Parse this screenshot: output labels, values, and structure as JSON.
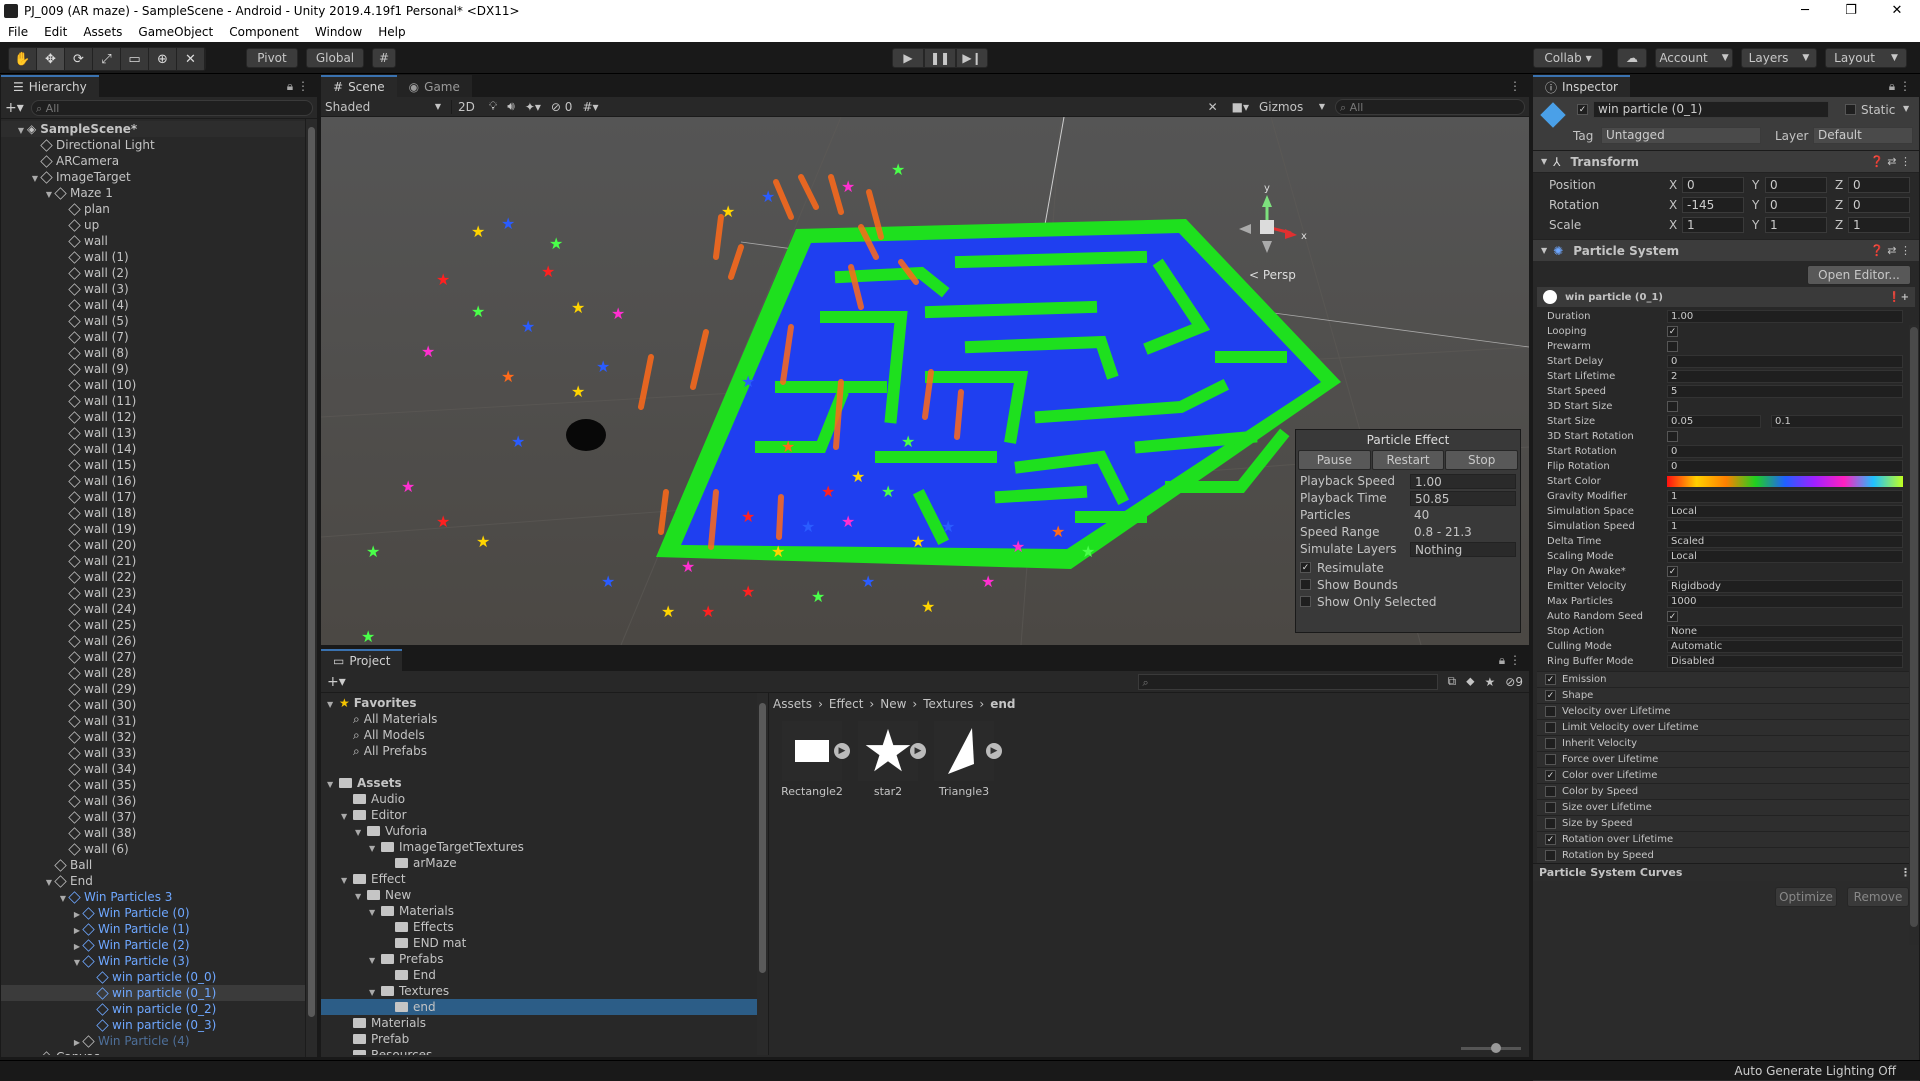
{
  "titlebar": {
    "title": "PJ_009 (AR maze) - SampleScene - Android - Unity 2019.4.19f1 Personal* <DX11>",
    "minimize": "─",
    "maximize": "❐",
    "close": "✕"
  },
  "menu": [
    "File",
    "Edit",
    "Assets",
    "GameObject",
    "Component",
    "Window",
    "Help"
  ],
  "toolbar": {
    "tools": [
      "✋",
      "✥",
      "⟳",
      "⤢",
      "▭",
      "⊕",
      "✕"
    ],
    "pivot": "Pivot",
    "global": "Global",
    "grid": "#",
    "play": "▶",
    "pause": "❚❚",
    "step": "▶❙",
    "collab": "Collab ▾",
    "cloud": "☁",
    "account": "Account",
    "layers": "Layers",
    "layout": "Layout"
  },
  "hierarchy": {
    "tab": "Hierarchy",
    "search_placeholder": "All",
    "scene": "SampleScene*",
    "items": [
      {
        "label": "Directional Light",
        "level": 1,
        "arrow": "",
        "style": ""
      },
      {
        "label": "ARCamera",
        "level": 1,
        "arrow": "",
        "style": ""
      },
      {
        "label": "ImageTarget",
        "level": 1,
        "arrow": "▼",
        "style": ""
      },
      {
        "label": "Maze 1",
        "level": 2,
        "arrow": "▼",
        "style": ""
      },
      {
        "label": "plan",
        "level": 3,
        "arrow": "",
        "style": ""
      },
      {
        "label": "up",
        "level": 3,
        "arrow": "",
        "style": ""
      },
      {
        "label": "wall",
        "level": 3,
        "arrow": "",
        "style": ""
      },
      {
        "label": "wall (1)",
        "level": 3,
        "arrow": "",
        "style": ""
      },
      {
        "label": "wall (2)",
        "level": 3,
        "arrow": "",
        "style": ""
      },
      {
        "label": "wall (3)",
        "level": 3,
        "arrow": "",
        "style": ""
      },
      {
        "label": "wall (4)",
        "level": 3,
        "arrow": "",
        "style": ""
      },
      {
        "label": "wall (5)",
        "level": 3,
        "arrow": "",
        "style": ""
      },
      {
        "label": "wall (7)",
        "level": 3,
        "arrow": "",
        "style": ""
      },
      {
        "label": "wall (8)",
        "level": 3,
        "arrow": "",
        "style": ""
      },
      {
        "label": "wall (9)",
        "level": 3,
        "arrow": "",
        "style": ""
      },
      {
        "label": "wall (10)",
        "level": 3,
        "arrow": "",
        "style": ""
      },
      {
        "label": "wall (11)",
        "level": 3,
        "arrow": "",
        "style": ""
      },
      {
        "label": "wall (12)",
        "level": 3,
        "arrow": "",
        "style": ""
      },
      {
        "label": "wall (13)",
        "level": 3,
        "arrow": "",
        "style": ""
      },
      {
        "label": "wall (14)",
        "level": 3,
        "arrow": "",
        "style": ""
      },
      {
        "label": "wall (15)",
        "level": 3,
        "arrow": "",
        "style": ""
      },
      {
        "label": "wall (16)",
        "level": 3,
        "arrow": "",
        "style": ""
      },
      {
        "label": "wall (17)",
        "level": 3,
        "arrow": "",
        "style": ""
      },
      {
        "label": "wall (18)",
        "level": 3,
        "arrow": "",
        "style": ""
      },
      {
        "label": "wall (19)",
        "level": 3,
        "arrow": "",
        "style": ""
      },
      {
        "label": "wall (20)",
        "level": 3,
        "arrow": "",
        "style": ""
      },
      {
        "label": "wall (21)",
        "level": 3,
        "arrow": "",
        "style": ""
      },
      {
        "label": "wall (22)",
        "level": 3,
        "arrow": "",
        "style": ""
      },
      {
        "label": "wall (23)",
        "level": 3,
        "arrow": "",
        "style": ""
      },
      {
        "label": "wall (24)",
        "level": 3,
        "arrow": "",
        "style": ""
      },
      {
        "label": "wall (25)",
        "level": 3,
        "arrow": "",
        "style": ""
      },
      {
        "label": "wall (26)",
        "level": 3,
        "arrow": "",
        "style": ""
      },
      {
        "label": "wall (27)",
        "level": 3,
        "arrow": "",
        "style": ""
      },
      {
        "label": "wall (28)",
        "level": 3,
        "arrow": "",
        "style": ""
      },
      {
        "label": "wall (29)",
        "level": 3,
        "arrow": "",
        "style": ""
      },
      {
        "label": "wall (30)",
        "level": 3,
        "arrow": "",
        "style": ""
      },
      {
        "label": "wall (31)",
        "level": 3,
        "arrow": "",
        "style": ""
      },
      {
        "label": "wall (32)",
        "level": 3,
        "arrow": "",
        "style": ""
      },
      {
        "label": "wall (33)",
        "level": 3,
        "arrow": "",
        "style": ""
      },
      {
        "label": "wall (34)",
        "level": 3,
        "arrow": "",
        "style": ""
      },
      {
        "label": "wall (35)",
        "level": 3,
        "arrow": "",
        "style": ""
      },
      {
        "label": "wall (36)",
        "level": 3,
        "arrow": "",
        "style": ""
      },
      {
        "label": "wall (37)",
        "level": 3,
        "arrow": "",
        "style": ""
      },
      {
        "label": "wall (38)",
        "level": 3,
        "arrow": "",
        "style": ""
      },
      {
        "label": "wall (6)",
        "level": 3,
        "arrow": "",
        "style": ""
      },
      {
        "label": "Ball",
        "level": 2,
        "arrow": "",
        "style": ""
      },
      {
        "label": "End",
        "level": 2,
        "arrow": "▼",
        "style": ""
      },
      {
        "label": "Win Particles 3",
        "level": 3,
        "arrow": "▼",
        "style": "blue"
      },
      {
        "label": "Win Particle (0)",
        "level": 4,
        "arrow": "▶",
        "style": "blue"
      },
      {
        "label": "Win Particle (1)",
        "level": 4,
        "arrow": "▶",
        "style": "blue"
      },
      {
        "label": "Win Particle (2)",
        "level": 4,
        "arrow": "▶",
        "style": "blue"
      },
      {
        "label": "Win Particle (3)",
        "level": 4,
        "arrow": "▼",
        "style": "blue"
      },
      {
        "label": "win particle (0_0)",
        "level": 5,
        "arrow": "",
        "style": "blue"
      },
      {
        "label": "win particle (0_1)",
        "level": 5,
        "arrow": "",
        "style": "selected"
      },
      {
        "label": "win particle (0_2)",
        "level": 5,
        "arrow": "",
        "style": "blue"
      },
      {
        "label": "win particle (0_3)",
        "level": 5,
        "arrow": "",
        "style": "blue"
      },
      {
        "label": "Win Particle (4)",
        "level": 4,
        "arrow": "▶",
        "style": "dim"
      },
      {
        "label": "Canvas",
        "level": 1,
        "arrow": "▶",
        "style": ""
      }
    ]
  },
  "scene": {
    "tab_scene": "Scene",
    "tab_game": "Game",
    "shading": "Shaded",
    "mode_2d": "2D",
    "hidden_count": "0",
    "gizmos": "Gizmos",
    "search_placeholder": "All",
    "persp": "< Persp",
    "gizmo_y": "y",
    "gizmo_x": "x"
  },
  "particle_effect": {
    "title": "Particle Effect",
    "pause": "Pause",
    "restart": "Restart",
    "stop": "Stop",
    "rows": [
      {
        "label": "Playback Speed",
        "value": "1.00"
      },
      {
        "label": "Playback Time",
        "value": "50.85"
      },
      {
        "label": "Particles",
        "value": "40"
      },
      {
        "label": "Speed Range",
        "value": "0.8 - 21.3"
      },
      {
        "label": "Simulate Layers",
        "value": "Nothing"
      }
    ],
    "checks": [
      {
        "label": "Resimulate",
        "checked": "✓"
      },
      {
        "label": "Show Bounds",
        "checked": ""
      },
      {
        "label": "Show Only Selected",
        "checked": ""
      }
    ]
  },
  "project": {
    "tab": "Project",
    "count": "9",
    "breadcrumb": [
      "Assets",
      "Effect",
      "New",
      "Textures",
      "end"
    ],
    "tree": [
      {
        "label": "Favorites",
        "level": 0,
        "arrow": "▼",
        "icon": "star",
        "bold": true
      },
      {
        "label": "All Materials",
        "level": 1,
        "arrow": "",
        "icon": "search",
        "bold": false
      },
      {
        "label": "All Models",
        "level": 1,
        "arrow": "",
        "icon": "search",
        "bold": false
      },
      {
        "label": "All Prefabs",
        "level": 1,
        "arrow": "",
        "icon": "search",
        "bold": false
      },
      {
        "label": "",
        "level": 0,
        "arrow": "",
        "icon": "",
        "bold": false
      },
      {
        "label": "Assets",
        "level": 0,
        "arrow": "▼",
        "icon": "folder",
        "bold": true
      },
      {
        "label": "Audio",
        "level": 1,
        "arrow": "",
        "icon": "folder",
        "bold": false
      },
      {
        "label": "Editor",
        "level": 1,
        "arrow": "▼",
        "icon": "folder",
        "bold": false
      },
      {
        "label": "Vuforia",
        "level": 2,
        "arrow": "▼",
        "icon": "folder",
        "bold": false
      },
      {
        "label": "ImageTargetTextures",
        "level": 3,
        "arrow": "▼",
        "icon": "folder",
        "bold": false
      },
      {
        "label": "arMaze",
        "level": 4,
        "arrow": "",
        "icon": "folder",
        "bold": false
      },
      {
        "label": "Effect",
        "level": 1,
        "arrow": "▼",
        "icon": "folder",
        "bold": false
      },
      {
        "label": "New",
        "level": 2,
        "arrow": "▼",
        "icon": "folder",
        "bold": false
      },
      {
        "label": "Materials",
        "level": 3,
        "arrow": "▼",
        "icon": "folder",
        "bold": false
      },
      {
        "label": "Effects",
        "level": 4,
        "arrow": "",
        "icon": "folder",
        "bold": false
      },
      {
        "label": "END mat",
        "level": 4,
        "arrow": "",
        "icon": "folder",
        "bold": false
      },
      {
        "label": "Prefabs",
        "level": 3,
        "arrow": "▼",
        "icon": "folder",
        "bold": false
      },
      {
        "label": "End",
        "level": 4,
        "arrow": "",
        "icon": "folder",
        "bold": false
      },
      {
        "label": "Textures",
        "level": 3,
        "arrow": "▼",
        "icon": "folder",
        "bold": false
      },
      {
        "label": "end",
        "level": 4,
        "arrow": "",
        "icon": "folder",
        "bold": false,
        "selected": true
      },
      {
        "label": "Materials",
        "level": 1,
        "arrow": "",
        "icon": "folder",
        "bold": false
      },
      {
        "label": "Prefab",
        "level": 1,
        "arrow": "",
        "icon": "folder",
        "bold": false
      },
      {
        "label": "Resources",
        "level": 1,
        "arrow": "",
        "icon": "folder",
        "bold": false
      }
    ],
    "assets": [
      {
        "label": "Rectangle2",
        "shape": "rect"
      },
      {
        "label": "star2",
        "shape": "star"
      },
      {
        "label": "Triangle3",
        "shape": "tri"
      }
    ]
  },
  "inspector": {
    "tab": "Inspector",
    "object_name": "win particle (0_1)",
    "static": "Static",
    "tag_label": "Tag",
    "tag_value": "Untagged",
    "layer_label": "Layer",
    "layer_value": "Default",
    "transform_title": "Transform",
    "transform": [
      {
        "label": "Position",
        "x": "0",
        "y": "0",
        "z": "0"
      },
      {
        "label": "Rotation",
        "x": "-145",
        "y": "0",
        "z": "0"
      },
      {
        "label": "Scale",
        "x": "1",
        "y": "1",
        "z": "1"
      }
    ],
    "axis_x": "X",
    "axis_y": "Y",
    "axis_z": "Z",
    "ps_title": "Particle System",
    "open_editor": "Open Editor...",
    "ps_name": "win particle (0_1)",
    "ps_rows": [
      {
        "label": "Duration",
        "value": "1.00",
        "kind": "text"
      },
      {
        "label": "Looping",
        "value": "✓",
        "kind": "check"
      },
      {
        "label": "Prewarm",
        "value": "",
        "kind": "check"
      },
      {
        "label": "Start Delay",
        "value": "0",
        "kind": "text"
      },
      {
        "label": "Start Lifetime",
        "value": "2",
        "kind": "text"
      },
      {
        "label": "Start Speed",
        "value": "5",
        "kind": "text"
      },
      {
        "label": "3D Start Size",
        "value": "",
        "kind": "check"
      },
      {
        "label": "Start Size",
        "value": "0.05",
        "kind": "range",
        "value2": "0.1"
      },
      {
        "label": "3D Start Rotation",
        "value": "",
        "kind": "check"
      },
      {
        "label": "Start Rotation",
        "value": "0",
        "kind": "text"
      },
      {
        "label": "Flip Rotation",
        "value": "0",
        "kind": "text"
      },
      {
        "label": "Start Color",
        "value": "",
        "kind": "gradient"
      },
      {
        "label": "Gravity Modifier",
        "value": "1",
        "kind": "text"
      },
      {
        "label": "Simulation Space",
        "value": "Local",
        "kind": "text"
      },
      {
        "label": "Simulation Speed",
        "value": "1",
        "kind": "text"
      },
      {
        "label": "Delta Time",
        "value": "Scaled",
        "kind": "text"
      },
      {
        "label": "Scaling Mode",
        "value": "Local",
        "kind": "text"
      },
      {
        "label": "Play On Awake*",
        "value": "✓",
        "kind": "check"
      },
      {
        "label": "Emitter Velocity",
        "value": "Rigidbody",
        "kind": "text"
      },
      {
        "label": "Max Particles",
        "value": "1000",
        "kind": "text"
      },
      {
        "label": "Auto Random Seed",
        "value": "✓",
        "kind": "check"
      },
      {
        "label": "Stop Action",
        "value": "None",
        "kind": "text"
      },
      {
        "label": "Culling Mode",
        "value": "Automatic",
        "kind": "text"
      },
      {
        "label": "Ring Buffer Mode",
        "value": "Disabled",
        "kind": "text"
      }
    ],
    "modules": [
      {
        "label": "Emission",
        "checked": "✓"
      },
      {
        "label": "Shape",
        "checked": "✓"
      },
      {
        "label": "Velocity over Lifetime",
        "checked": ""
      },
      {
        "label": "Limit Velocity over Lifetime",
        "checked": ""
      },
      {
        "label": "Inherit Velocity",
        "checked": ""
      },
      {
        "label": "Force over Lifetime",
        "checked": ""
      },
      {
        "label": "Color over Lifetime",
        "checked": "✓"
      },
      {
        "label": "Color by Speed",
        "checked": ""
      },
      {
        "label": "Size over Lifetime",
        "checked": ""
      },
      {
        "label": "Size by Speed",
        "checked": ""
      },
      {
        "label": "Rotation over Lifetime",
        "checked": "✓"
      },
      {
        "label": "Rotation by Speed",
        "checked": ""
      }
    ],
    "curves_title": "Particle System Curves",
    "optimize": "Optimize",
    "remove": "Remove"
  },
  "statusbar": {
    "text": "Auto Generate Lighting Off"
  },
  "colors": {
    "accent": "#3a72b0",
    "selection": "#2c5d87",
    "maze_floor": "#1f3ff0",
    "maze_wall": "#1ee01e",
    "scene_bg": "#4d4a47"
  }
}
